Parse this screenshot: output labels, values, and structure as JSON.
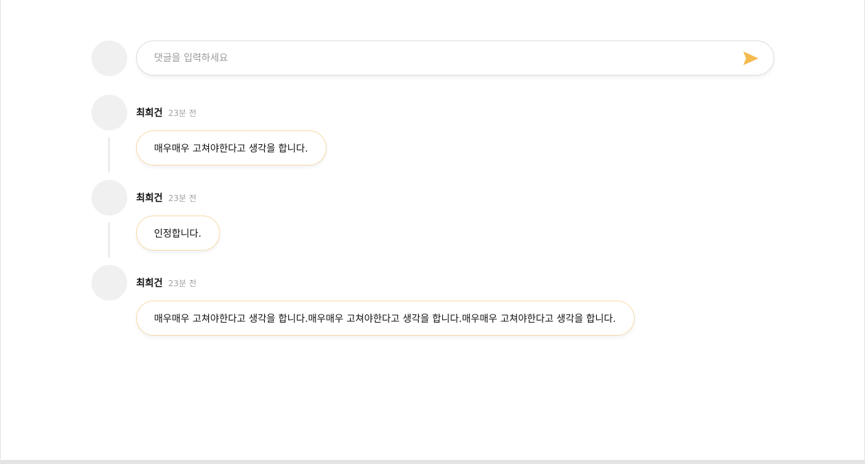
{
  "input": {
    "placeholder": "댓글을 입력하세요",
    "value": ""
  },
  "send_button": {
    "icon": "send-icon",
    "color": "#F5B94E"
  },
  "comments": [
    {
      "author": "최희건",
      "time": "23분 전",
      "text": "매우매우 고쳐야한다고 생각을 합니다."
    },
    {
      "author": "최희건",
      "time": "23분 전",
      "text": "인정합니다."
    },
    {
      "author": "최희건",
      "time": "23분 전",
      "text": "매우매우 고쳐야한다고 생각을 합니다.매우매우 고쳐야한다고 생각을 합니다.매우매우 고쳐야한다고 생각을 합니다."
    }
  ],
  "colors": {
    "accent": "#F5B94E",
    "bubble_border": "#F7D9A6",
    "avatar": "#F0F0F0"
  }
}
